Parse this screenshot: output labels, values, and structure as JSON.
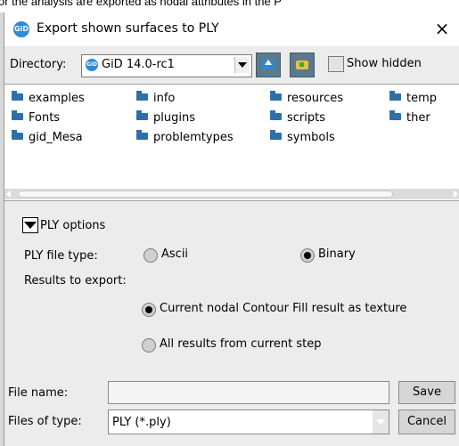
{
  "background_strip": {
    "text": "or the analysis are exported as nodal attributes in the P"
  },
  "window": {
    "title": "Export shown surfaces to PLY",
    "logo_text": "GiD",
    "close_glyph": "×"
  },
  "directory": {
    "label": "Directory:",
    "value": "GiD 14.0-rc1",
    "show_hidden_label": "Show hidden"
  },
  "files": [
    "examples",
    "info",
    "resources",
    "temp",
    "Fonts",
    "plugins",
    "scripts",
    "ther",
    "gid_Mesa",
    "problemtypes",
    "symbols"
  ],
  "ply_options": {
    "section_title": "PLY options",
    "file_type_label": "PLY file type:",
    "file_type_options": [
      "Ascii",
      "Binary"
    ],
    "file_type_selected": "Binary",
    "results_label": "Results to export:",
    "results_options": [
      "Current nodal Contour Fill result as texture",
      "All results from current step"
    ],
    "results_selected": "Current nodal Contour Fill result as texture"
  },
  "footer": {
    "file_name_label": "File name:",
    "file_name_value": "",
    "files_of_type_label": "Files of type:",
    "files_of_type_value": "PLY (*.ply)",
    "save_label": "Save",
    "cancel_label": "Cancel"
  },
  "colors": {
    "accent": "#2d8ad6",
    "tool_button": "#5a7a8c",
    "folder": "#2d6fa8"
  },
  "icons": {
    "title": "gid-logo-icon",
    "close": "close-icon",
    "up_folder": "folder-up-icon",
    "new_folder": "new-folder-icon",
    "folder": "folder-icon",
    "toggle": "collapse-triangle-icon"
  }
}
